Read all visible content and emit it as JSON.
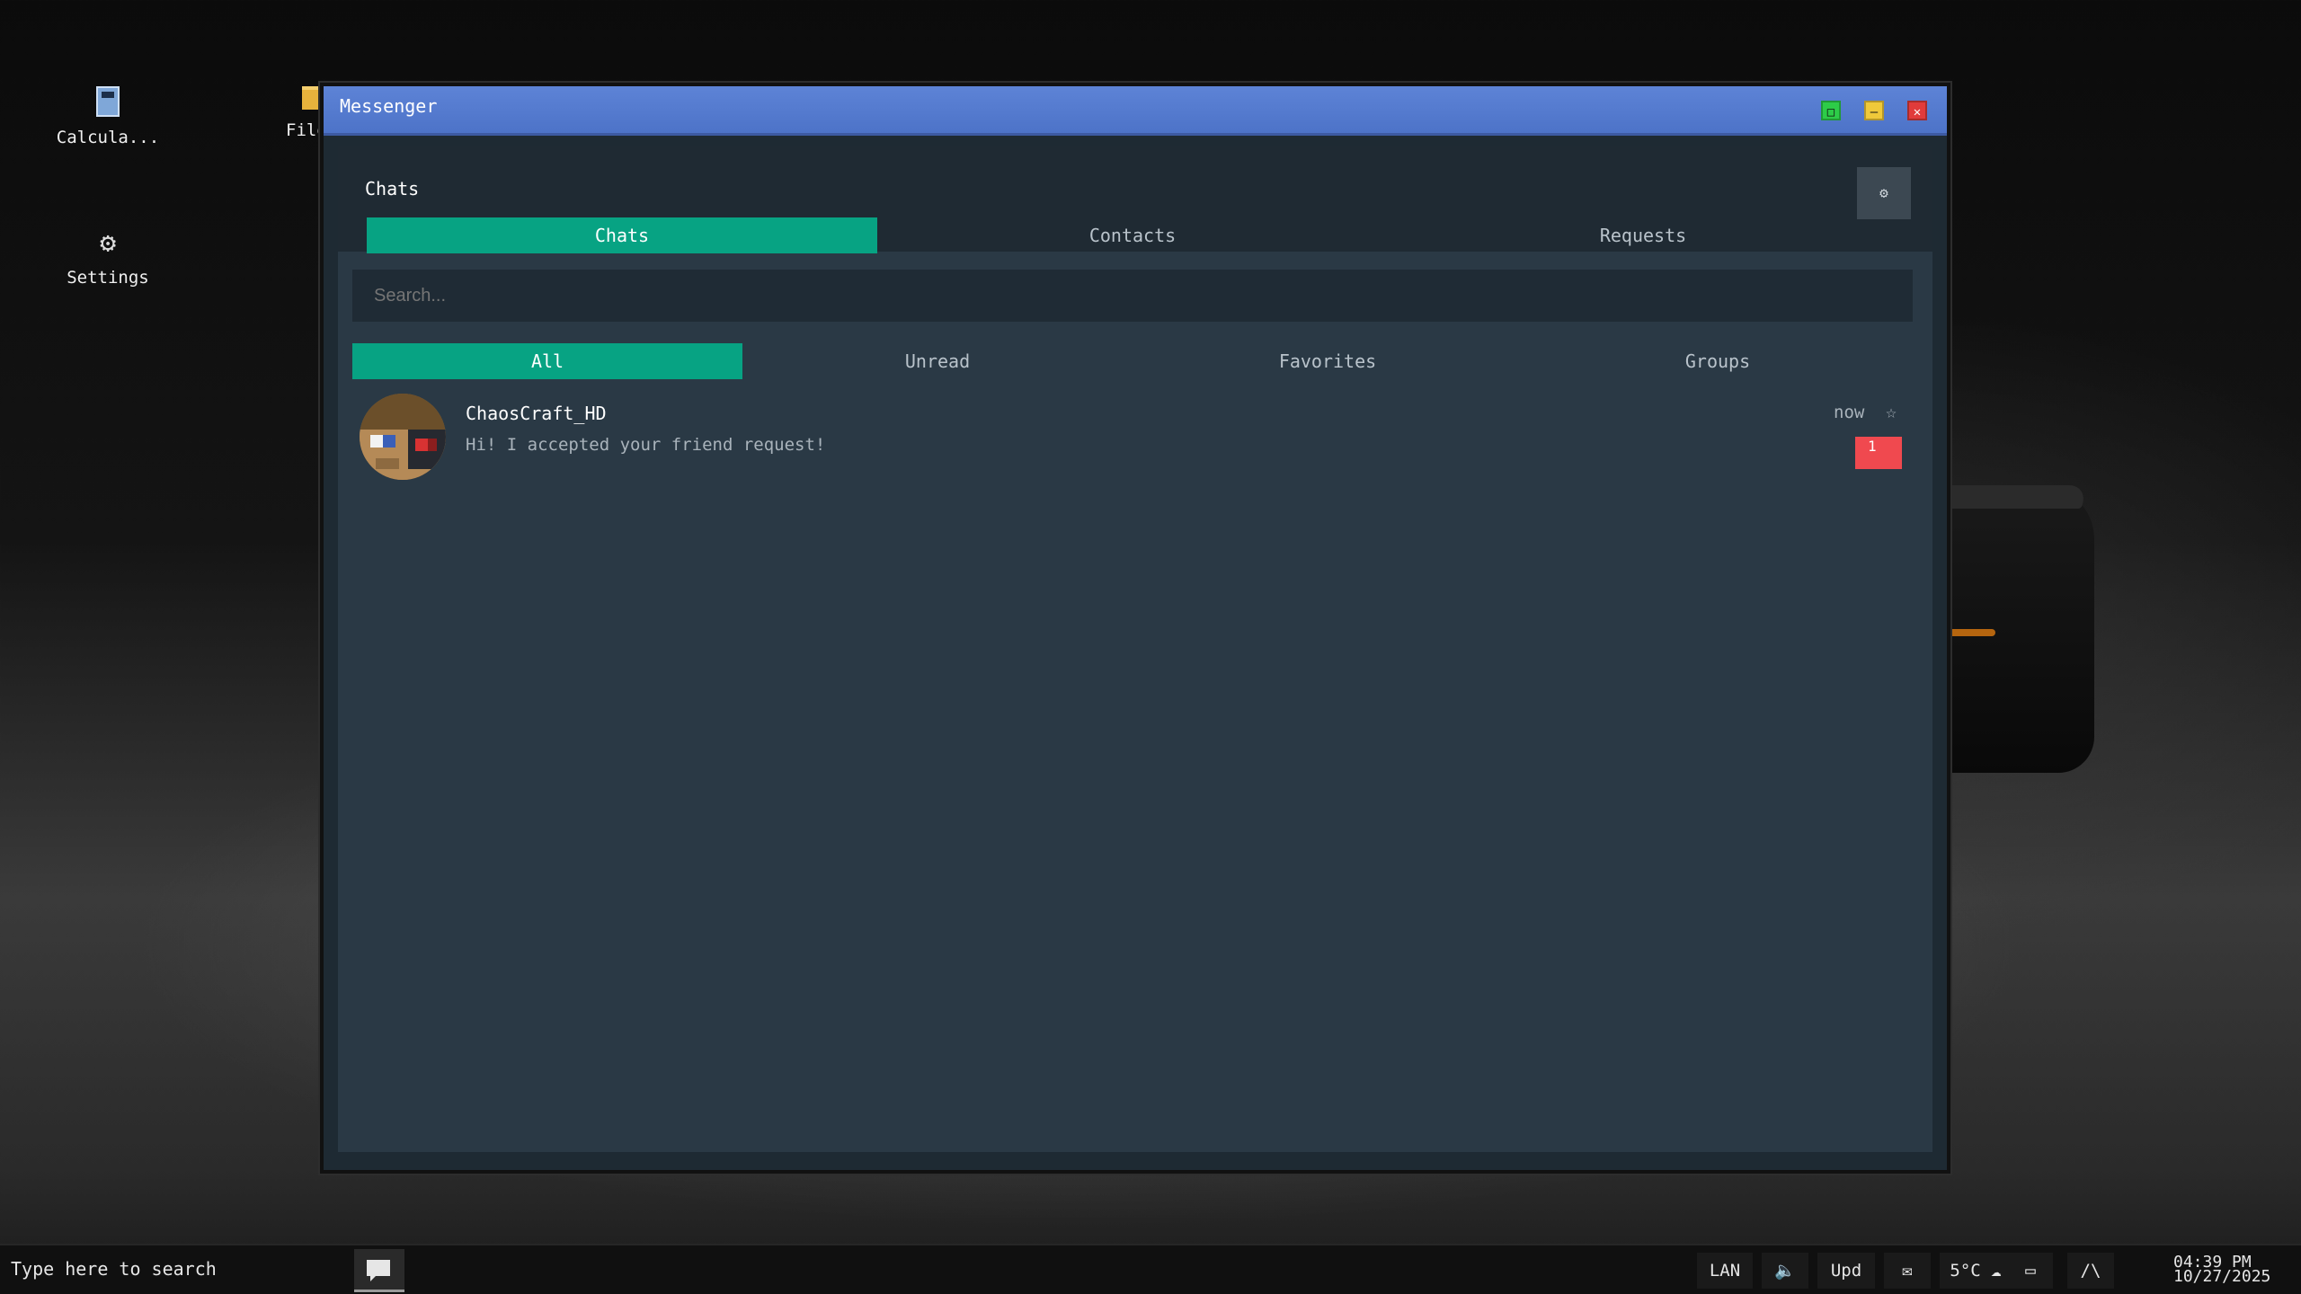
{
  "desktop": {
    "icons": [
      {
        "label": "Calcula...",
        "icon": "calculator-icon"
      },
      {
        "label": "Files",
        "icon": "folder-icon"
      },
      {
        "label": "Settings",
        "icon": "gear-icon"
      }
    ]
  },
  "window": {
    "title": "Messenger",
    "controls": {
      "maximize": "□",
      "minimize": "—",
      "close": "✕"
    }
  },
  "messenger": {
    "header_title": "Chats",
    "settings_icon": "⚙",
    "tabs": [
      {
        "label": "Chats",
        "active": true
      },
      {
        "label": "Contacts",
        "active": false
      },
      {
        "label": "Requests",
        "active": false
      }
    ],
    "search": {
      "placeholder": "Search..."
    },
    "filters": [
      {
        "label": "All",
        "active": true
      },
      {
        "label": "Unread",
        "active": false
      },
      {
        "label": "Favorites",
        "active": false
      },
      {
        "label": "Groups",
        "active": false
      }
    ],
    "chats": [
      {
        "name": "ChaosCraft_HD",
        "message": "Hi! I accepted your friend request!",
        "time": "now",
        "favorite_icon": "☆",
        "unread": "1"
      }
    ]
  },
  "taskbar": {
    "search_placeholder": "Type here to search",
    "tray": {
      "network": "LAN",
      "volume_icon": "🔈",
      "updates": "Upd",
      "mail_icon": "✉",
      "weather": "5°C ☁",
      "battery_icon": "▭",
      "chevron": "/\\"
    },
    "clock": {
      "time": "04:39 PM",
      "date": "10/27/2025"
    }
  },
  "colors": {
    "accent": "#07a383",
    "titlebar": "#4d73c8",
    "badge": "#f0494f",
    "panel": "#2a3945"
  }
}
